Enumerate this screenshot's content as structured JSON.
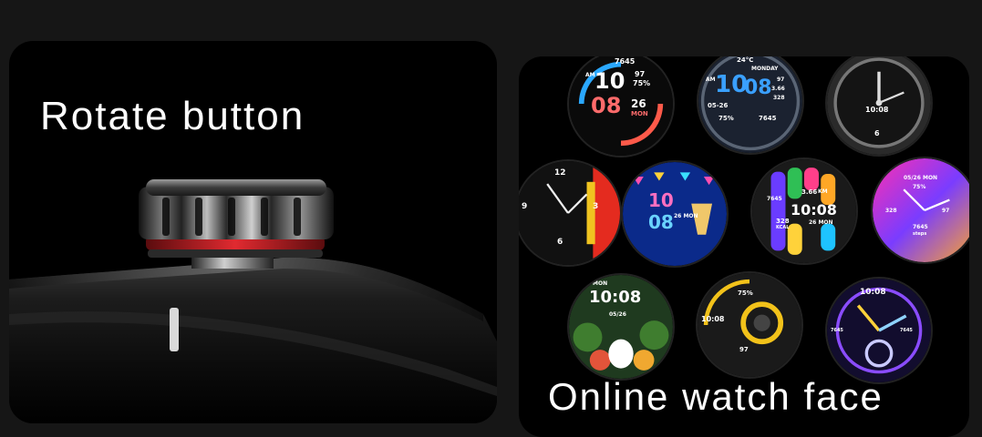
{
  "left_panel": {
    "title": "Rotate button"
  },
  "right_panel": {
    "caption": "Online watch face",
    "faces": [
      {
        "name": "face-1",
        "lines": [
          "7645",
          "10",
          "08",
          "97",
          "75%",
          "26",
          "MON",
          "AM"
        ]
      },
      {
        "name": "face-2",
        "lines": [
          "24°C",
          "MONDAY",
          "AM",
          "10",
          "08",
          "97",
          "3.66",
          "328",
          "05-26",
          "75%",
          "7645"
        ]
      },
      {
        "name": "face-3",
        "lines": [
          "10:08",
          "6"
        ]
      },
      {
        "name": "face-4",
        "lines": [
          "12",
          "6",
          "3",
          "9"
        ]
      },
      {
        "name": "face-5",
        "lines": [
          "10",
          "08",
          "26 MON"
        ]
      },
      {
        "name": "face-6",
        "lines": [
          "3.66",
          "KM",
          "7645",
          "10:08",
          "328",
          "KCAL",
          "26 MON"
        ]
      },
      {
        "name": "face-7",
        "lines": [
          "05/26 MON",
          "75%",
          "328",
          "97",
          "7645",
          "steps"
        ]
      },
      {
        "name": "face-8",
        "lines": [
          "10:08",
          "MON",
          "05/26"
        ]
      },
      {
        "name": "face-9",
        "lines": [
          "75%",
          "10:08",
          "97"
        ]
      },
      {
        "name": "face-10",
        "lines": [
          "10:08",
          "7645",
          "7645"
        ]
      }
    ]
  },
  "colors": {
    "background": "#161616",
    "panel": "#000000",
    "accent_red": "#d8232a",
    "text": "#ffffff"
  }
}
